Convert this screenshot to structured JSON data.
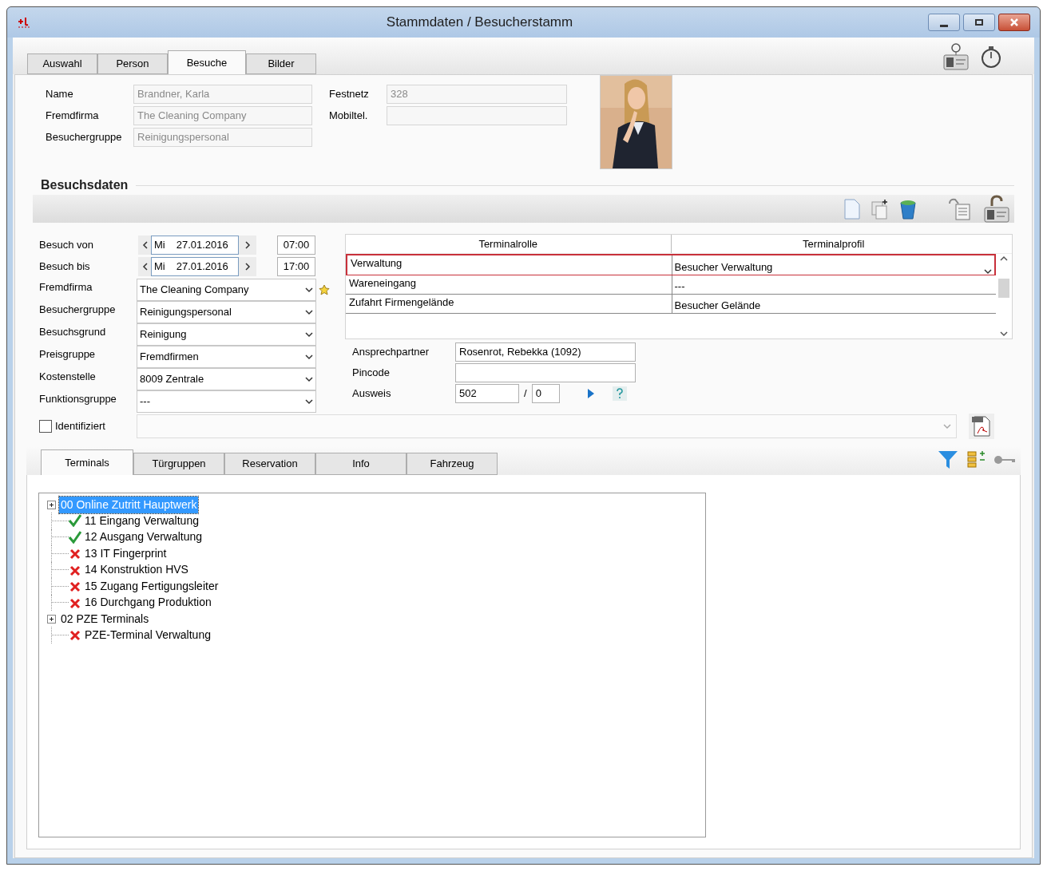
{
  "window": {
    "title": "Stammdaten / Besucherstamm"
  },
  "main_tabs": [
    {
      "label": "Auswahl",
      "selected": false
    },
    {
      "label": "Person",
      "selected": false
    },
    {
      "label": "Besuche",
      "selected": true
    },
    {
      "label": "Bilder",
      "selected": false
    }
  ],
  "person": {
    "left": [
      {
        "label": "Name",
        "value": "Brandner, Karla"
      },
      {
        "label": "Fremdfirma",
        "value": "The Cleaning Company"
      },
      {
        "label": "Besuchergruppe",
        "value": "Reinigungspersonal"
      }
    ],
    "right": [
      {
        "label": "Festnetz",
        "value": "328"
      },
      {
        "label": "Mobiltel."
      }
    ]
  },
  "section_title": "Besuchsdaten",
  "dates": [
    {
      "label": "Besuch von",
      "weekday": "Mi",
      "date": "27.01.2016",
      "time": "07:00"
    },
    {
      "label": "Besuch bis",
      "weekday": "Mi",
      "date": "27.01.2016",
      "time": "17:00"
    }
  ],
  "combos": [
    {
      "label": "Fremdfirma",
      "value": "The Cleaning Company"
    },
    {
      "label": "Besuchergruppe",
      "value": "Reinigungspersonal"
    },
    {
      "label": "Besuchsgrund",
      "value": "Reinigung"
    },
    {
      "label": "Preisgruppe",
      "value": "Fremdfirmen"
    },
    {
      "label": "Kostenstelle",
      "value": "8009 Zentrale"
    },
    {
      "label": "Funktionsgruppe",
      "value": "---"
    }
  ],
  "identified": {
    "label": "Identifiziert",
    "checked": false
  },
  "terminal_grid": {
    "columns": [
      "Terminalrolle",
      "Terminalprofil"
    ],
    "rows": [
      {
        "role": "Verwaltung",
        "profile": "Besucher Verwaltung",
        "selected": true
      },
      {
        "role": "Wareneingang",
        "profile": "---",
        "selected": false
      },
      {
        "role": "Zufahrt Firmengelände",
        "profile": "Besucher Gelände",
        "selected": false
      }
    ]
  },
  "contact": {
    "ansprechpartner": {
      "label": "Ansprechpartner",
      "value": "Rosenrot, Rebekka (1092)"
    },
    "pincode": {
      "label": "Pincode"
    },
    "ausweis": {
      "label": "Ausweis",
      "value": "502",
      "separator": "/",
      "suffix": "0"
    }
  },
  "detail_tabs": [
    {
      "label": "Terminals",
      "selected": true
    },
    {
      "label": "Türgruppen",
      "selected": false
    },
    {
      "label": "Reservation",
      "selected": false
    },
    {
      "label": "Info",
      "selected": false
    },
    {
      "label": "Fahrzeug",
      "selected": false
    }
  ],
  "tree": [
    {
      "label": "00 Online Zutritt Hauptwerk",
      "selected": true,
      "children": [
        {
          "label": "11 Eingang Verwaltung",
          "granted": true
        },
        {
          "label": "12 Ausgang Verwaltung",
          "granted": true
        },
        {
          "label": "13 IT Fingerprint",
          "granted": false
        },
        {
          "label": "14 Konstruktion HVS",
          "granted": false
        },
        {
          "label": "15 Zugang Fertigungsleiter",
          "granted": false
        },
        {
          "label": "16 Durchgang Produktion",
          "granted": false
        }
      ]
    },
    {
      "label": "02 PZE Terminals",
      "selected": false,
      "children": [
        {
          "label": "PZE-Terminal Verwaltung",
          "granted": false
        }
      ]
    }
  ]
}
